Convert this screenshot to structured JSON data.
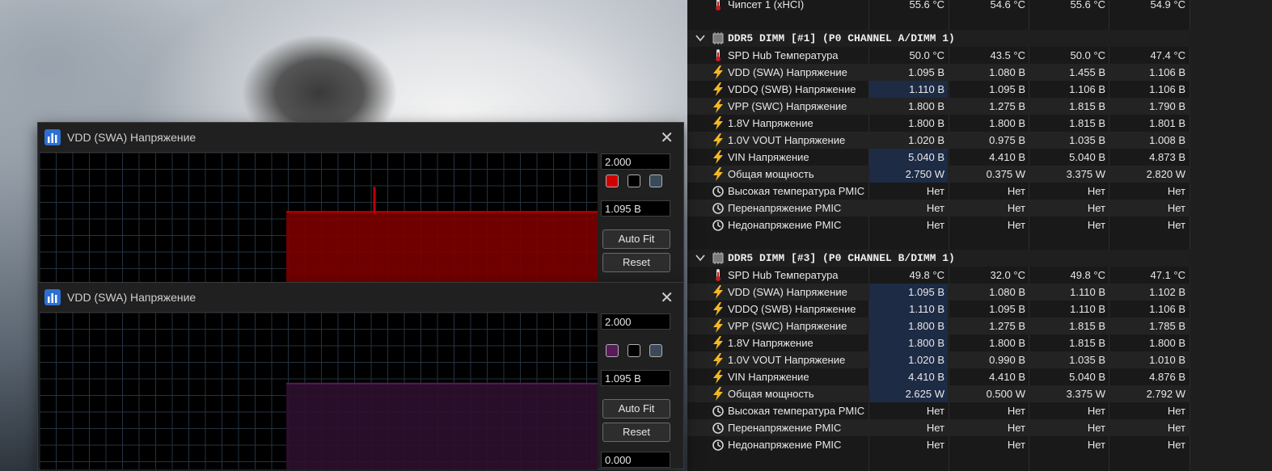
{
  "graph_windows": [
    {
      "title": "VDD (SWA) Напряжение",
      "max_value": "2.000",
      "current_value": "1.095 В",
      "autofit_label": "Auto Fit",
      "reset_label": "Reset",
      "line_color": "#c00000",
      "fill_color": "#7a0000",
      "data_level": 1.095,
      "scale_max": 2.0
    },
    {
      "title": "VDD (SWA) Напряжение",
      "max_value": "2.000",
      "current_value": "1.095 В",
      "min_value": "0.000",
      "autofit_label": "Auto Fit",
      "reset_label": "Reset",
      "line_color": "#5a1a5a",
      "fill_color": "#2c0f2c",
      "data_level": 1.095,
      "scale_max": 2.0
    }
  ],
  "top_row": {
    "label": "Чипсет 1 (xHCI)",
    "values": [
      "55.6 °C",
      "54.6 °C",
      "55.6 °C",
      "54.9 °C"
    ]
  },
  "groups": [
    {
      "title": "DDR5 DIMM [#1] (P0 CHANNEL A/DIMM 1)",
      "rows": [
        {
          "icon": "thermometer",
          "label": "SPD Hub Температура",
          "values": [
            "50.0 °C",
            "43.5 °C",
            "50.0 °C",
            "47.4 °C"
          ]
        },
        {
          "icon": "lightning",
          "label": "VDD (SWA) Напряжение",
          "values": [
            "1.095 В",
            "1.080 В",
            "1.455 В",
            "1.106 В"
          ]
        },
        {
          "icon": "lightning",
          "label": "VDDQ (SWB) Напряжение",
          "values": [
            "1.110 В",
            "1.095 В",
            "1.106 В",
            "1.106 В"
          ]
        },
        {
          "icon": "lightning",
          "label": "VPP (SWC) Напряжение",
          "values": [
            "1.800 В",
            "1.275 В",
            "1.815 В",
            "1.790 В"
          ]
        },
        {
          "icon": "lightning",
          "label": "1.8V Напряжение",
          "values": [
            "1.800 В",
            "1.800 В",
            "1.815 В",
            "1.801 В"
          ]
        },
        {
          "icon": "lightning",
          "label": "1.0V VOUT Напряжение",
          "values": [
            "1.020 В",
            "0.975 В",
            "1.035 В",
            "1.008 В"
          ]
        },
        {
          "icon": "lightning",
          "label": "VIN Напряжение",
          "values": [
            "5.040 В",
            "4.410 В",
            "5.040 В",
            "4.873 В"
          ]
        },
        {
          "icon": "lightning",
          "label": "Общая мощность",
          "values": [
            "2.750 W",
            "0.375 W",
            "3.375 W",
            "2.820 W"
          ]
        },
        {
          "icon": "clock",
          "label": "Высокая температура PMIC",
          "values": [
            "Нет",
            "Нет",
            "Нет",
            "Нет"
          ]
        },
        {
          "icon": "clock",
          "label": "Перенапряжение PMIC",
          "values": [
            "Нет",
            "Нет",
            "Нет",
            "Нет"
          ]
        },
        {
          "icon": "clock",
          "label": "Недонапряжение PMIC",
          "values": [
            "Нет",
            "Нет",
            "Нет",
            "Нет"
          ]
        }
      ]
    },
    {
      "title": "DDR5 DIMM [#3] (P0 CHANNEL B/DIMM 1)",
      "rows": [
        {
          "icon": "thermometer",
          "label": "SPD Hub Температура",
          "values": [
            "49.8 °C",
            "32.0 °C",
            "49.8 °C",
            "47.1 °C"
          ]
        },
        {
          "icon": "lightning",
          "label": "VDD (SWA) Напряжение",
          "values": [
            "1.095 В",
            "1.080 В",
            "1.110 В",
            "1.102 В"
          ]
        },
        {
          "icon": "lightning",
          "label": "VDDQ (SWB) Напряжение",
          "values": [
            "1.110 В",
            "1.095 В",
            "1.110 В",
            "1.106 В"
          ]
        },
        {
          "icon": "lightning",
          "label": "VPP (SWC) Напряжение",
          "values": [
            "1.800 В",
            "1.275 В",
            "1.815 В",
            "1.785 В"
          ]
        },
        {
          "icon": "lightning",
          "label": "1.8V Напряжение",
          "values": [
            "1.800 В",
            "1.800 В",
            "1.815 В",
            "1.800 В"
          ]
        },
        {
          "icon": "lightning",
          "label": "1.0V VOUT Напряжение",
          "values": [
            "1.020 В",
            "0.990 В",
            "1.035 В",
            "1.010 В"
          ]
        },
        {
          "icon": "lightning",
          "label": "VIN Напряжение",
          "values": [
            "4.410 В",
            "4.410 В",
            "5.040 В",
            "4.876 В"
          ]
        },
        {
          "icon": "lightning",
          "label": "Общая мощность",
          "values": [
            "2.625 W",
            "0.500 W",
            "3.375 W",
            "2.792 W"
          ]
        },
        {
          "icon": "clock",
          "label": "Высокая температура PMIC",
          "values": [
            "Нет",
            "Нет",
            "Нет",
            "Нет"
          ]
        },
        {
          "icon": "clock",
          "label": "Перенапряжение PMIC",
          "values": [
            "Нет",
            "Нет",
            "Нет",
            "Нет"
          ]
        },
        {
          "icon": "clock",
          "label": "Недонапряжение PMIC",
          "values": [
            "Нет",
            "Нет",
            "Нет",
            "Нет"
          ]
        }
      ]
    }
  ]
}
